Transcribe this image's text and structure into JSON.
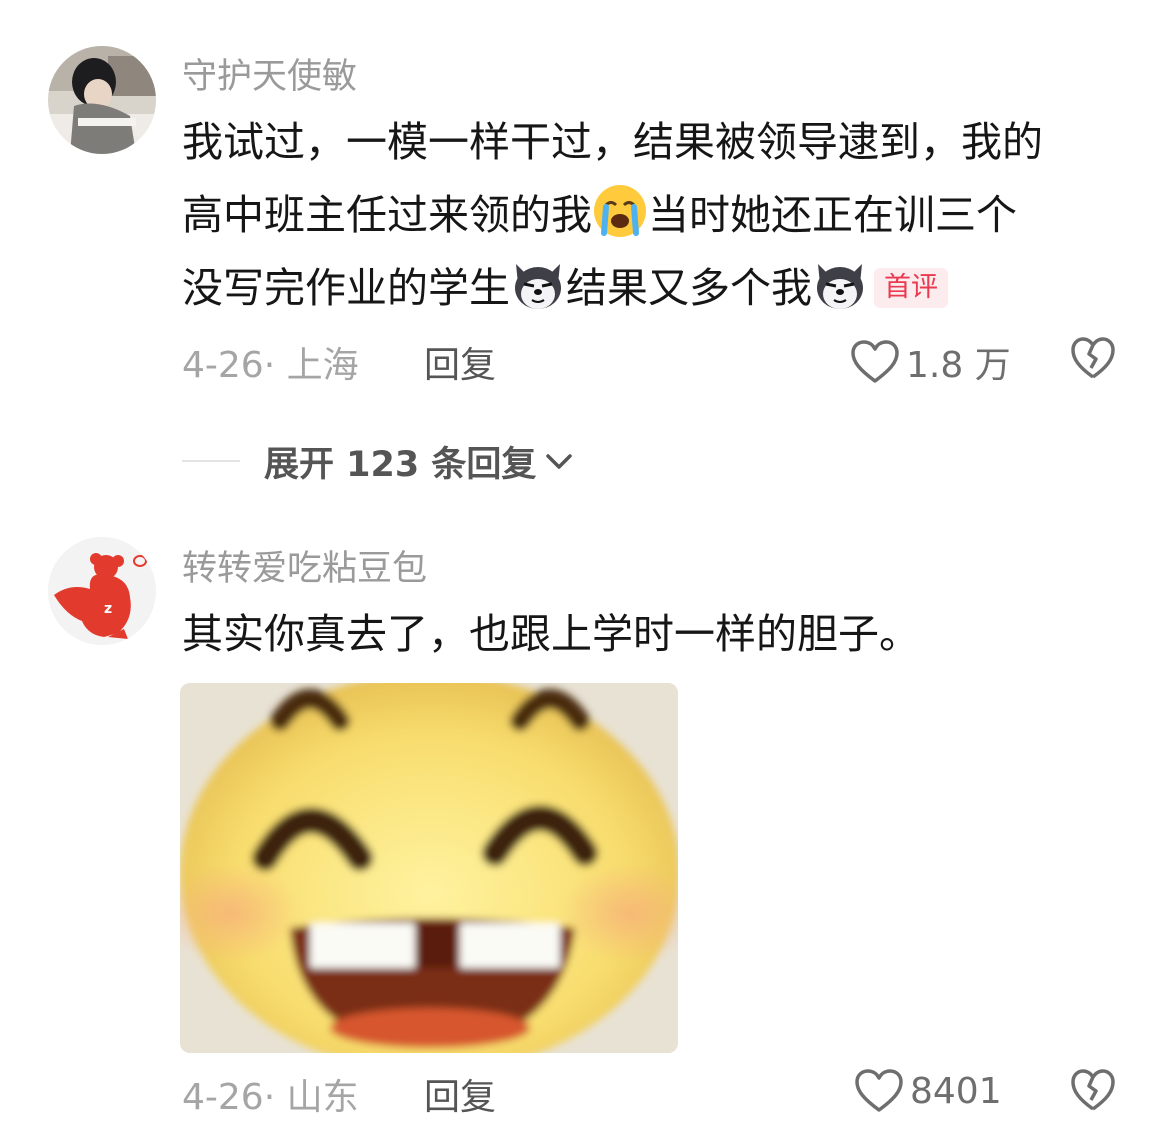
{
  "comments": [
    {
      "username": "守护天使敏",
      "lines": [
        {
          "t1": "我试过，一模一样干过，结果被领导逮到，我的"
        },
        {
          "t1": "高中班主任过来领的我",
          "t2": "当时她还正在训三个"
        },
        {
          "t1": "没写完作业的学生",
          "t2": "结果又多个我"
        }
      ],
      "emojis": [
        "crying-emoji",
        "husky-emoji",
        "husky-emoji"
      ],
      "badge": "首评",
      "date_location": "4-26· 上海",
      "reply_label": "回复",
      "like_count": "1.8 万",
      "accent": "#ea3a50"
    },
    {
      "username": "转转爱吃粘豆包",
      "text": "其实你真去了，也跟上学时一样的胆子。",
      "image": "laughing-emoji-sticker",
      "date_location": "4-26· 山东",
      "reply_label": "回复",
      "like_count": "8401"
    }
  ],
  "expand_replies": {
    "label": "展开 123 条回复",
    "icon": "chevron-down-icon"
  }
}
